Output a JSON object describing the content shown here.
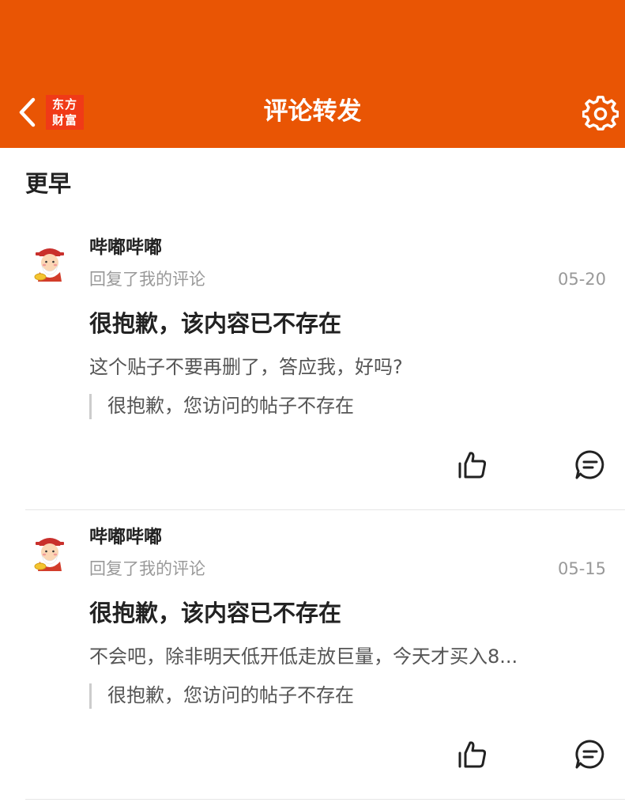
{
  "header": {
    "title": "评论转发",
    "logo_line1": "东方",
    "logo_line2": "财富",
    "back_icon": "chevron-left-icon",
    "settings_icon": "gear-icon",
    "background_color": "#e95504",
    "logo_color": "#f03a17"
  },
  "section": {
    "title": "更早"
  },
  "items": [
    {
      "username": "哔嘟哔嘟",
      "subtitle": "回复了我的评论",
      "date": "05-20",
      "post_title": "很抱歉，该内容已不存在",
      "comment": "这个贴子不要再删了，答应我，好吗?",
      "quote": "很抱歉，您访问的帖子不存在",
      "like_icon": "thumbs-up-icon",
      "reply_icon": "comment-icon"
    },
    {
      "username": "哔嘟哔嘟",
      "subtitle": "回复了我的评论",
      "date": "05-15",
      "post_title": "很抱歉，该内容已不存在",
      "comment": "不会吧，除非明天低开低走放巨量，今天才买入8...",
      "quote": "很抱歉，您访问的帖子不存在",
      "like_icon": "thumbs-up-icon",
      "reply_icon": "comment-icon"
    }
  ]
}
